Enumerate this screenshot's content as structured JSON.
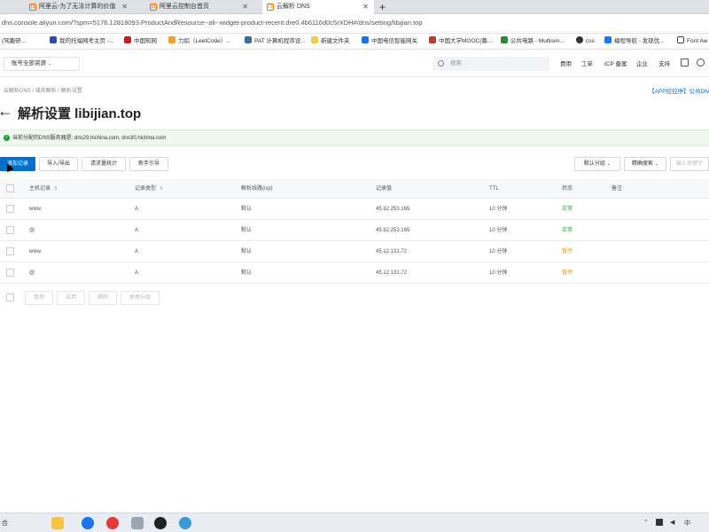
{
  "browser": {
    "tabs": [
      {
        "label": "阿里云-为了无法计算的价值",
        "active": false
      },
      {
        "label": "阿里云控制台首页",
        "active": false
      },
      {
        "label": "云解析 DNS",
        "active": true
      }
    ],
    "url": "dns.console.aliyun.com/?spm=5176.12818093.ProductAndResource--ali--widget-product-recent.dre0.4b6116d0c5rXDH#/dns/setting/libijian.top",
    "bookmarks": [
      "(驾趣研...",
      "我的托福网考主页 -...",
      "中国知网",
      "力扣（LeetCode）...",
      "PAT 计算机程序设...",
      "新建文件夹",
      "中国电信智能网关",
      "中国大学MOOC(慕...",
      "公共电路 - Multisim...",
      "css",
      "编程导航 - 发现优...",
      "Font Aw"
    ]
  },
  "console": {
    "workspace_select": "账号全部资源",
    "search_placeholder": "搜索",
    "nav": [
      "费用",
      "工单",
      "ICP 备案",
      "企业",
      "支持"
    ]
  },
  "breadcrumb": [
    "云解析DNS",
    "域名解析",
    "解析设置"
  ],
  "top_right_link": "【APP控控停】公共DN",
  "page_title": "解析设置 libijian.top",
  "dns_info": "当前分配的DNS服务器是: dns29.hichina.com, dns30.hichina.com",
  "toolbar": {
    "add_record": "添加记录",
    "import_export": "导入/导出",
    "request_stats": "请求量统计",
    "guide": "新手引导",
    "group_select": "默认分组",
    "search_mode": "精确搜索",
    "keyword_placeholder": "输入关键字"
  },
  "table": {
    "headers": {
      "host": "主机记录",
      "type": "记录类型",
      "line": "解析线路(isp)",
      "value": "记录值",
      "ttl": "TTL",
      "status": "状态",
      "remark": "备注"
    },
    "rows": [
      {
        "host": "www",
        "type": "A",
        "line": "默认",
        "value": "45.82.253.165",
        "ttl": "10 分钟",
        "status": "正常"
      },
      {
        "host": "@",
        "type": "A",
        "line": "默认",
        "value": "45.82.253.165",
        "ttl": "10 分钟",
        "status": "正常"
      },
      {
        "host": "www",
        "type": "A",
        "line": "默认",
        "value": "45.12.131.72",
        "ttl": "10 分钟",
        "status": "暂停"
      },
      {
        "host": "@",
        "type": "A",
        "line": "默认",
        "value": "45.12.131.72",
        "ttl": "10 分钟",
        "status": "暂停"
      }
    ]
  },
  "bulk_actions": [
    "暂停",
    "启用",
    "删除",
    "更换分组"
  ],
  "taskbar_left": "合",
  "colors": {
    "primary": "#0070cc",
    "ok_green": "#1e9e3e",
    "paused_orange": "#f29900"
  }
}
